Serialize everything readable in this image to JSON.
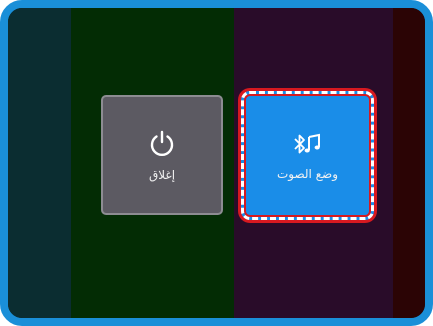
{
  "tiles": {
    "power": {
      "label": "إغلاق",
      "icon": "power-icon"
    },
    "sound_mode": {
      "label": "وضع الصوت",
      "icon": "bluetooth-music-icon",
      "selected": true
    }
  },
  "colors": {
    "frame": "#1a8fd8",
    "selected_tile": "#1a8de8",
    "power_tile": "#5c5a62",
    "selection_outline": "#d71920"
  }
}
